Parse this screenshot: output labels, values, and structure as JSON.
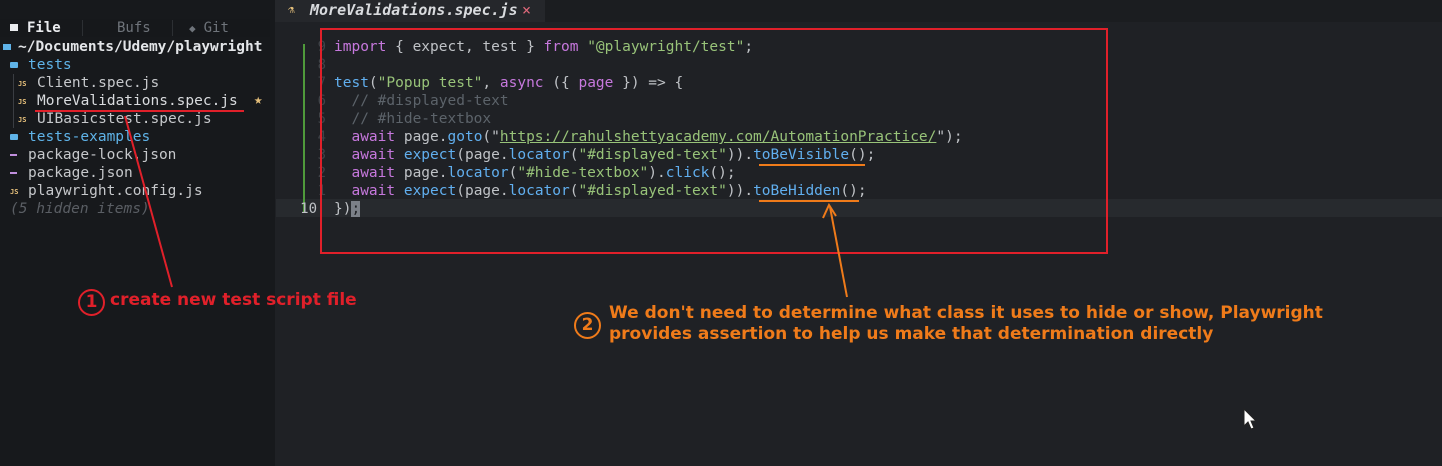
{
  "sidebar": {
    "tabs": [
      "File",
      "Bufs",
      "Git"
    ],
    "tab_icons": [
      "folder-icon",
      "",
      "git-diamond-icon"
    ],
    "root": "~/Documents/Udemy/playwright",
    "items": [
      {
        "label": "tests",
        "kind": "folder-open"
      },
      {
        "label": "Client.spec.js",
        "kind": "js"
      },
      {
        "label": "MoreValidations.spec.js",
        "kind": "js",
        "starred": true
      },
      {
        "label": "UIBasicstest.spec.js",
        "kind": "js"
      },
      {
        "label": "tests-examples",
        "kind": "folder"
      },
      {
        "label": "package-lock.json",
        "kind": "json"
      },
      {
        "label": "package.json",
        "kind": "json"
      },
      {
        "label": "playwright.config.js",
        "kind": "js"
      },
      {
        "label": "(5 hidden items)",
        "kind": "hint"
      }
    ],
    "star_glyph": "★",
    "js_badge": "JS"
  },
  "editor": {
    "tab_title": "MoreValidations.spec.js",
    "tab_close": "×",
    "current_line": "10",
    "line_numbers": [
      "9",
      "8",
      "7",
      "6",
      "5",
      "4",
      "3",
      "2",
      "1",
      "10"
    ],
    "lines": {
      "l1": {
        "kw1": "import",
        "p1": " { expect, test } ",
        "kw2": "from",
        "p2": " ",
        "str": "\"@playwright/test\"",
        "p3": ";"
      },
      "l3": {
        "fn": "test",
        "p1": "(",
        "str": "\"Popup test\"",
        "p2": ", ",
        "kw": "async",
        "p3": " ({ ",
        "kw2": "page",
        "p4": " }) => {"
      },
      "l4": {
        "cm": "  // #displayed-text"
      },
      "l5": {
        "cm": "  // #hide-textbox"
      },
      "l6": {
        "kw": "  await",
        "p1": " page.",
        "fn": "goto",
        "p2": "(\"",
        "url": "https://rahulshettyacademy.com/AutomationPractice/",
        "p3": "\");"
      },
      "l7": {
        "kw": "  await",
        "p1": " ",
        "fn1": "expect",
        "p2": "(page.",
        "fn2": "locator",
        "p3": "(",
        "str": "\"#displayed-text\"",
        "p4": ")).",
        "fn3": "toBeVisible",
        "p5": "();"
      },
      "l8": {
        "kw": "  await",
        "p1": " page.",
        "fn1": "locator",
        "p2": "(",
        "str": "\"#hide-textbox\"",
        "p3": ").",
        "fn2": "click",
        "p4": "();"
      },
      "l9": {
        "kw": "  await",
        "p1": " ",
        "fn1": "expect",
        "p2": "(page.",
        "fn2": "locator",
        "p3": "(",
        "str": "\"#displayed-text\"",
        "p4": ")).",
        "fn3": "toBeHidden",
        "p5": "();"
      },
      "l10": {
        "p1": "})",
        "cursor": ";"
      }
    }
  },
  "annotations": {
    "one": {
      "number": "1",
      "text": "create new test script file",
      "color": "#e0202a"
    },
    "two": {
      "number": "2",
      "line1": "We don't need to determine what class it uses to hide or show, Playwright",
      "line2": "provides assertion to help us make that determination directly",
      "color": "#ef7b1a"
    }
  }
}
